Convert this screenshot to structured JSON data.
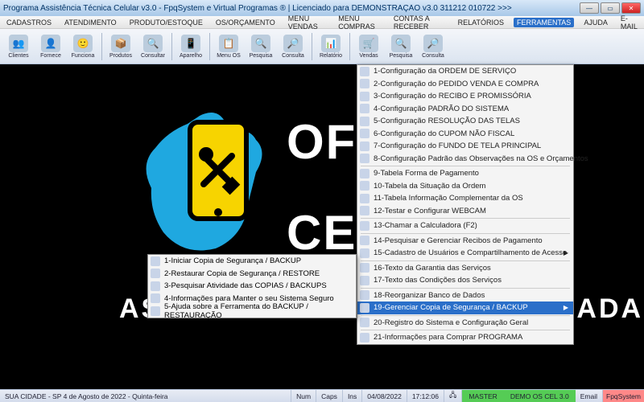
{
  "window": {
    "title": "Programa Assistência Técnica Celular v3.0 - FpqSystem e Virtual Programas ® | Licenciado para  DEMONSTRAÇÃO v3.0 311212 010722 >>>"
  },
  "menubar": {
    "items": [
      "CADASTROS",
      "ATENDIMENTO",
      "PRODUTO/ESTOQUE",
      "OS/ORÇAMENTO",
      "MENU VENDAS",
      "MENU COMPRAS",
      "CONTAS A RECEBER",
      "RELATÓRIOS",
      "FERRAMENTAS",
      "AJUDA",
      "E-MAIL"
    ],
    "activeIndex": 8
  },
  "toolbar": {
    "items": [
      {
        "label": "Clientes",
        "icon": "👥"
      },
      {
        "label": "Fornece",
        "icon": "👤"
      },
      {
        "label": "Funciona",
        "icon": "🙂"
      },
      {
        "sep": true
      },
      {
        "label": "Produtos",
        "icon": "📦"
      },
      {
        "label": "Consultar",
        "icon": "🔍"
      },
      {
        "sep": true
      },
      {
        "label": "Aparelho",
        "icon": "📱"
      },
      {
        "sep": true
      },
      {
        "label": "Menu OS",
        "icon": "📋"
      },
      {
        "label": "Pesquisa",
        "icon": "🔍"
      },
      {
        "label": "Consulta",
        "icon": "🔎"
      },
      {
        "sep": true
      },
      {
        "label": "Relatório",
        "icon": "📊"
      },
      {
        "sep": true
      },
      {
        "label": "Vendas",
        "icon": "🛒"
      },
      {
        "label": "Pesquisa",
        "icon": "🔍"
      },
      {
        "label": "Consulta",
        "icon": "🔎"
      }
    ]
  },
  "background": {
    "text1": "OFI",
    "text2": "CEL",
    "text3_left": "AS",
    "text3_right": "ESPECIALIZADA"
  },
  "ferramentas_menu": {
    "items": [
      {
        "label": "1-Configuração da ORDEM DE SERVIÇO"
      },
      {
        "label": "2-Configuração do PEDIDO VENDA E COMPRA"
      },
      {
        "label": "3-Configuração do RECIBO E PROMISSÓRIA"
      },
      {
        "label": "4-Configuração PADRÃO DO SISTEMA"
      },
      {
        "label": "5-Configuração RESOLUÇÃO DAS TELAS"
      },
      {
        "label": "6-Configuração do CUPOM NÃO FISCAL"
      },
      {
        "label": "7-Configuração do FUNDO DE TELA PRINCIPAL"
      },
      {
        "label": "8-Configuração Padrão das Observações na OS e Orçamentos"
      },
      {
        "sep": true
      },
      {
        "label": "9-Tabela Forma de Pagamento"
      },
      {
        "label": "10-Tabela da Situação da Ordem"
      },
      {
        "label": "11-Tabela Informação Complementar da OS"
      },
      {
        "label": "12-Testar e Configurar WEBCAM"
      },
      {
        "sep": true
      },
      {
        "label": "13-Chamar a Calculadora (F2)"
      },
      {
        "sep": true
      },
      {
        "label": "14-Pesquisar e Gerenciar Recibos de Pagamento"
      },
      {
        "label": "15-Cadastro de Usuários e Compartilhamento de Acesso",
        "arrow": true
      },
      {
        "sep": true
      },
      {
        "label": "16-Texto da Garantia das Serviços"
      },
      {
        "label": "17-Texto das Condições dos Serviços"
      },
      {
        "sep": true
      },
      {
        "label": "18-Reorganizar Banco de Dados"
      },
      {
        "label": "19-Gerenciar Copia de Segurança / BACKUP",
        "highlight": true,
        "arrow": true
      },
      {
        "sep": true
      },
      {
        "label": "20-Registro do Sistema e Configuração Geral"
      },
      {
        "sep": true
      },
      {
        "label": "21-Informações para Comprar PROGRAMA"
      }
    ]
  },
  "backup_submenu": {
    "items": [
      {
        "label": "1-Iniciar Copia de Segurança / BACKUP"
      },
      {
        "label": "2-Restaurar Copia de Segurança / RESTORE"
      },
      {
        "label": "3-Pesquisar Atividade das COPIAS / BACKUPS"
      },
      {
        "label": "4-Informações para Manter o seu Sistema Seguro"
      },
      {
        "label": "5-Ajuda sobre a Ferramenta do BACKUP / RESTAURAÇÃO"
      }
    ]
  },
  "statusbar": {
    "location": "SUA CIDADE - SP  4 de Agosto de 2022 - Quinta-feira",
    "num": "Num",
    "caps": "Caps",
    "ins": "Ins",
    "date": "04/08/2022",
    "time": "17:12:06",
    "master": "MASTER",
    "demo": "DEMO OS CEL 3.0",
    "email": "Email",
    "brand": "FpqSystem"
  }
}
